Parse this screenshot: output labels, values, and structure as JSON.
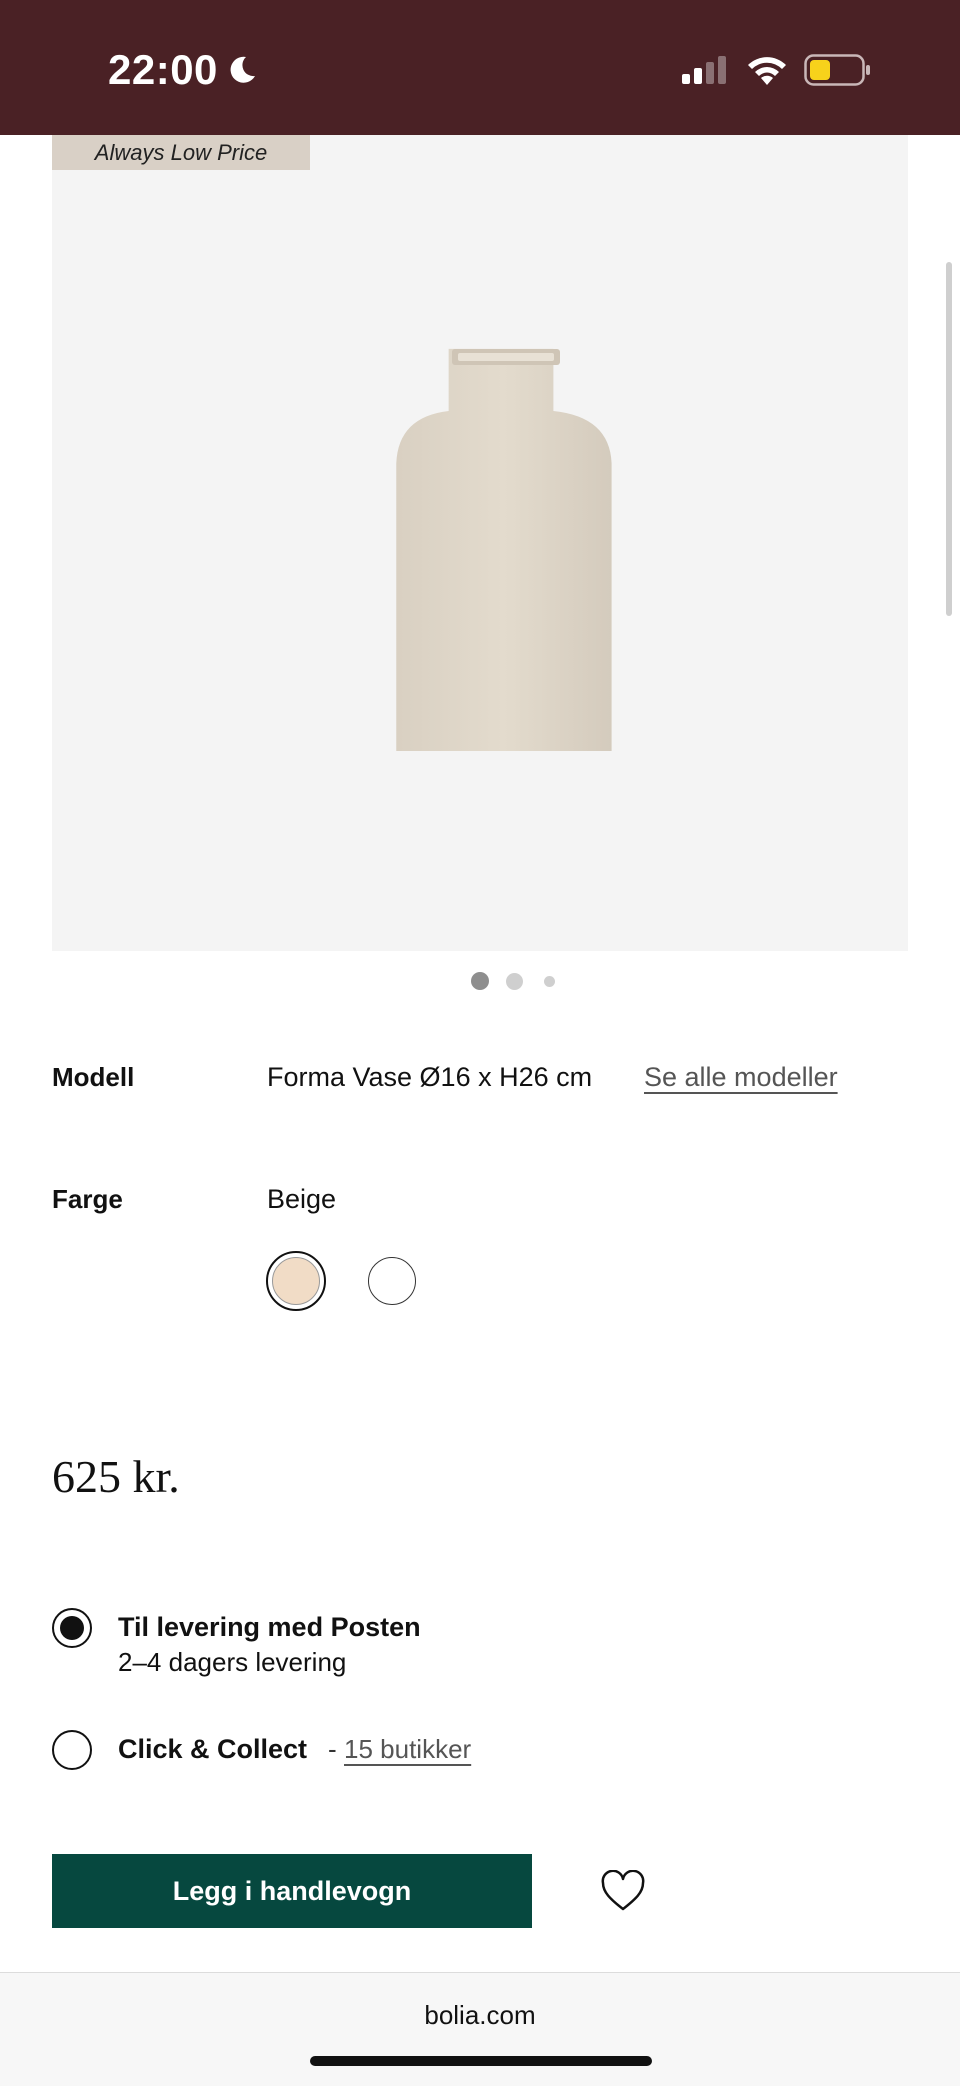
{
  "status_bar": {
    "time": "22:00",
    "icons": [
      "moon-icon",
      "signal-icon",
      "wifi-icon",
      "battery-icon"
    ],
    "background": "#4a2125"
  },
  "product": {
    "badge": "Always Low Price",
    "image_icon": "vase-image",
    "carousel": {
      "pages": 3,
      "active": 1
    }
  },
  "attributes": {
    "model": {
      "label": "Modell",
      "value": "Forma Vase Ø16 x H26 cm",
      "link": "Se alle modeller"
    },
    "color": {
      "label": "Farge",
      "value": "Beige",
      "swatches": [
        {
          "name": "Beige",
          "color": "#f1dcc6",
          "selected": true
        },
        {
          "name": "White",
          "color": "#ffffff",
          "selected": false
        }
      ]
    }
  },
  "price": "625 kr.",
  "delivery": {
    "options": [
      {
        "title": "Til levering med Posten",
        "subtitle": "2–4 dagers levering",
        "selected": true
      },
      {
        "title": "Click & Collect",
        "separator": "-",
        "link": "15 butikker",
        "selected": false
      }
    ]
  },
  "actions": {
    "add_to_cart": "Legg i handlevogn",
    "favorite_icon": "heart-icon",
    "button_color": "#06483f"
  },
  "browser": {
    "url": "bolia.com"
  }
}
